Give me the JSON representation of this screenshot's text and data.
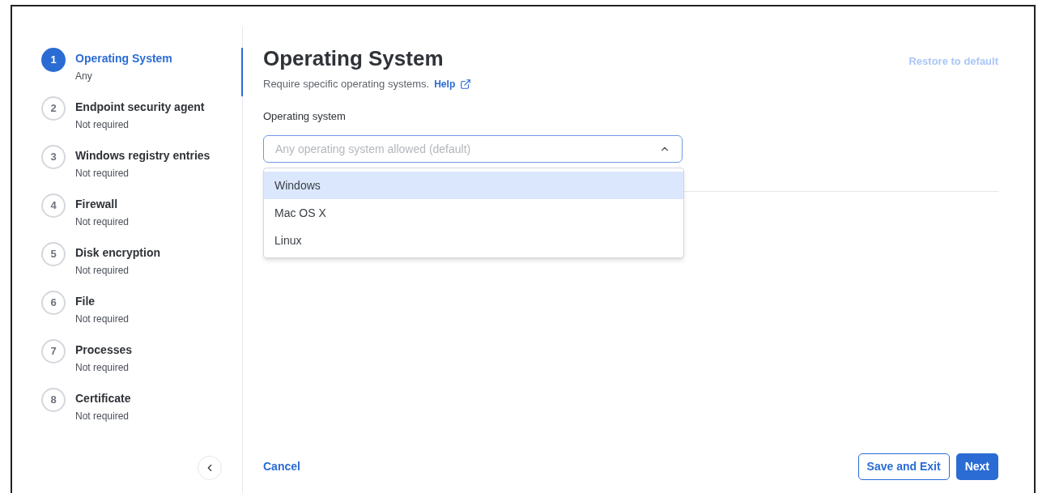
{
  "steps": [
    {
      "number": "1",
      "title": "Operating System",
      "status": "Any",
      "selected": true
    },
    {
      "number": "2",
      "title": "Endpoint security agent",
      "status": "Not required",
      "selected": false
    },
    {
      "number": "3",
      "title": "Windows registry entries",
      "status": "Not required",
      "selected": false
    },
    {
      "number": "4",
      "title": "Firewall",
      "status": "Not required",
      "selected": false
    },
    {
      "number": "5",
      "title": "Disk encryption",
      "status": "Not required",
      "selected": false
    },
    {
      "number": "6",
      "title": "File",
      "status": "Not required",
      "selected": false
    },
    {
      "number": "7",
      "title": "Processes",
      "status": "Not required",
      "selected": false
    },
    {
      "number": "8",
      "title": "Certificate",
      "status": "Not required",
      "selected": false
    }
  ],
  "header": {
    "title": "Operating System",
    "description": "Require specific operating systems.",
    "help_link": "Help",
    "restore": {
      "label": "Restore to default",
      "disabled": true
    }
  },
  "field": {
    "label": "Operating system",
    "placeholder": "Any operating system allowed (default)",
    "expanded": true,
    "options": [
      {
        "label": "Windows",
        "selected": true
      },
      {
        "label": "Mac OS X",
        "selected": false
      },
      {
        "label": "Linux",
        "selected": false
      }
    ]
  },
  "footer": {
    "cancel": "Cancel",
    "save_exit": "Save and Exit",
    "next": "Next"
  }
}
